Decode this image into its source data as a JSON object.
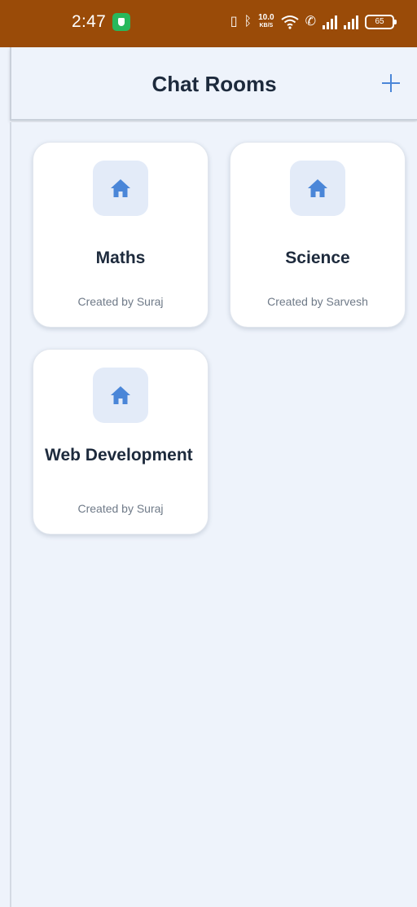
{
  "status_bar": {
    "time": "2:47",
    "speed_value": "10.0",
    "speed_unit": "KB/S",
    "battery": "65",
    "icons": [
      "shield-icon",
      "vibrate-icon",
      "bluetooth-icon",
      "wifi-icon",
      "call-icon",
      "signal-icon",
      "signal-icon",
      "battery-icon"
    ]
  },
  "header": {
    "title": "Chat Rooms",
    "add_icon": "plus-icon"
  },
  "rooms": [
    {
      "name": "Maths",
      "creator": "Created by Suraj",
      "icon": "home-icon"
    },
    {
      "name": "Science",
      "creator": "Created by Sarvesh",
      "icon": "home-icon"
    },
    {
      "name": "Web Development",
      "creator": "Created by Suraj",
      "icon": "home-icon"
    }
  ],
  "colors": {
    "status_bar": "#9a4b08",
    "accent": "#4a86d8",
    "background": "#eef3fb",
    "card": "#ffffff",
    "title_text": "#1d2a3c",
    "secondary_text": "#6f7a88"
  }
}
